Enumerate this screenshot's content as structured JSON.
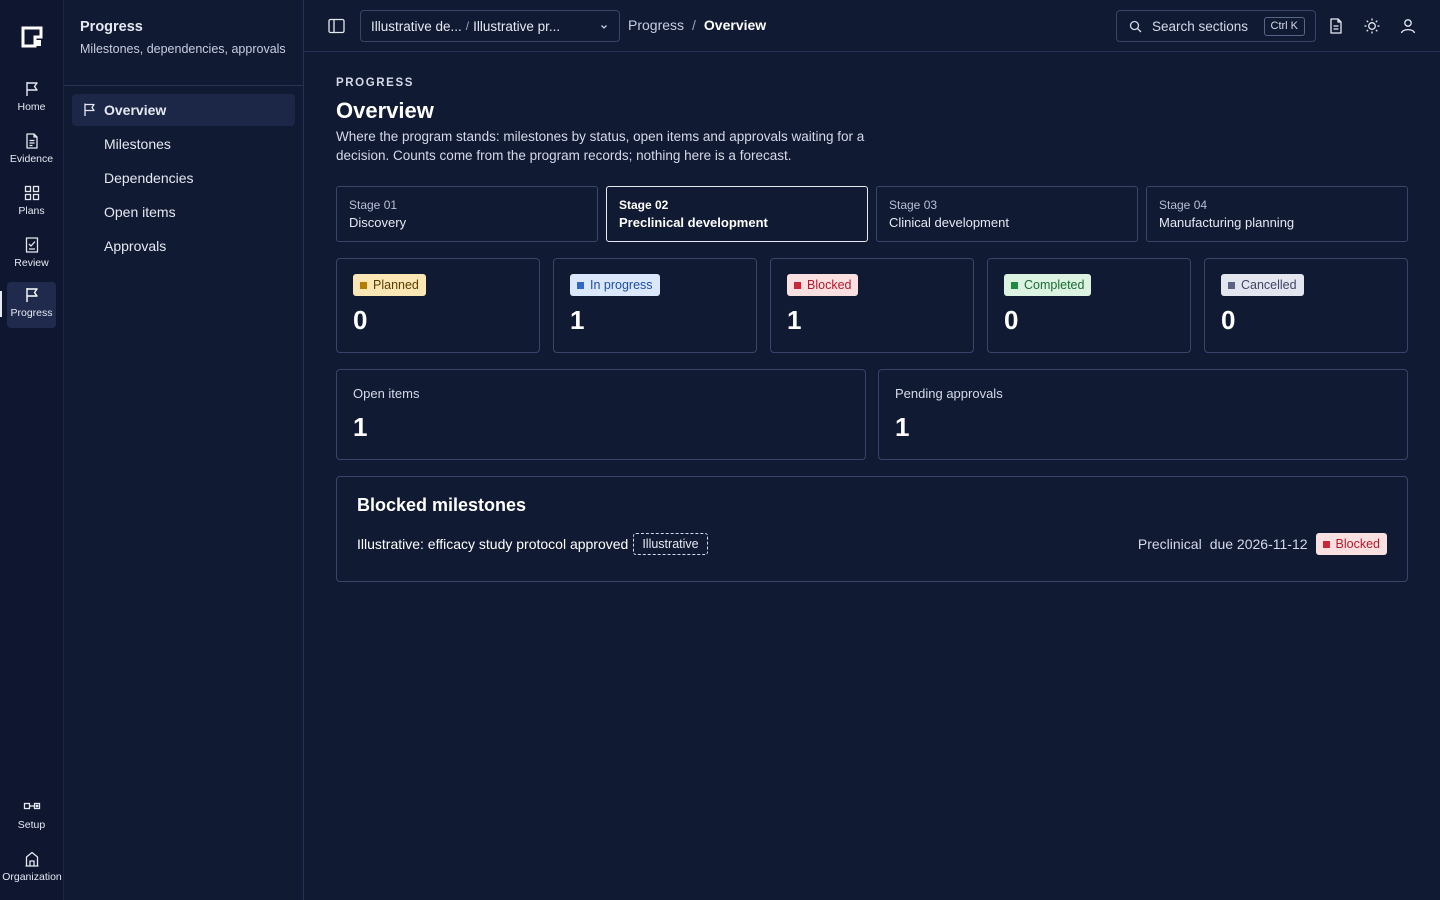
{
  "rail": {
    "items": [
      {
        "label": "Home",
        "icon": "flag-icon"
      },
      {
        "label": "Evidence",
        "icon": "document-icon"
      },
      {
        "label": "Plans",
        "icon": "grid-icon"
      },
      {
        "label": "Review",
        "icon": "checklist-icon"
      },
      {
        "label": "Progress",
        "icon": "flag-icon",
        "active": true
      }
    ],
    "bottom": [
      {
        "label": "Setup",
        "icon": "toggle-icon"
      },
      {
        "label": "Organization",
        "icon": "building-icon"
      }
    ]
  },
  "sidebar": {
    "title": "Progress",
    "subtitle": "Milestones, dependencies, approvals",
    "items": [
      {
        "label": "Overview",
        "active": true
      },
      {
        "label": "Milestones"
      },
      {
        "label": "Dependencies"
      },
      {
        "label": "Open items"
      },
      {
        "label": "Approvals"
      }
    ]
  },
  "topbar": {
    "select_part1": "Illustrative de...",
    "select_part2": "Illustrative pr...",
    "breadcrumb": {
      "section": "Progress",
      "page": "Overview"
    },
    "search_placeholder": "Search sections",
    "search_shortcut": "Ctrl K"
  },
  "main": {
    "eyebrow": "PROGRESS",
    "title": "Overview",
    "description": "Where the program stands: milestones by status, open items and approvals waiting for a decision. Counts come from the program records; nothing here is a forecast.",
    "stages": [
      {
        "number": "Stage 01",
        "name": "Discovery"
      },
      {
        "number": "Stage 02",
        "name": "Preclinical development",
        "active": true
      },
      {
        "number": "Stage 03",
        "name": "Clinical development"
      },
      {
        "number": "Stage 04",
        "name": "Manufacturing planning"
      }
    ],
    "status_counts": [
      {
        "label": "Planned",
        "value": "0"
      },
      {
        "label": "In progress",
        "value": "1"
      },
      {
        "label": "Blocked",
        "value": "1"
      },
      {
        "label": "Completed",
        "value": "0"
      },
      {
        "label": "Cancelled",
        "value": "0"
      }
    ],
    "open_items": {
      "label": "Open items",
      "value": "1"
    },
    "pending_approvals": {
      "label": "Pending approvals",
      "value": "1"
    },
    "blocked_milestones": {
      "title": "Blocked milestones",
      "rows": [
        {
          "name": "Illustrative: efficacy study protocol approved",
          "tag": "Illustrative",
          "phase": "Preclinical",
          "due": "due 2026-11-12",
          "status": "Blocked"
        }
      ]
    }
  },
  "colors": {
    "background": "#111a33",
    "rail": "#0f1730",
    "border": "#39446a",
    "planned": "#fbe7b5",
    "in_progress": "#dbe7fb",
    "blocked": "#fbe0e2",
    "completed": "#dcf3e2",
    "cancelled": "#e4e6ef"
  }
}
